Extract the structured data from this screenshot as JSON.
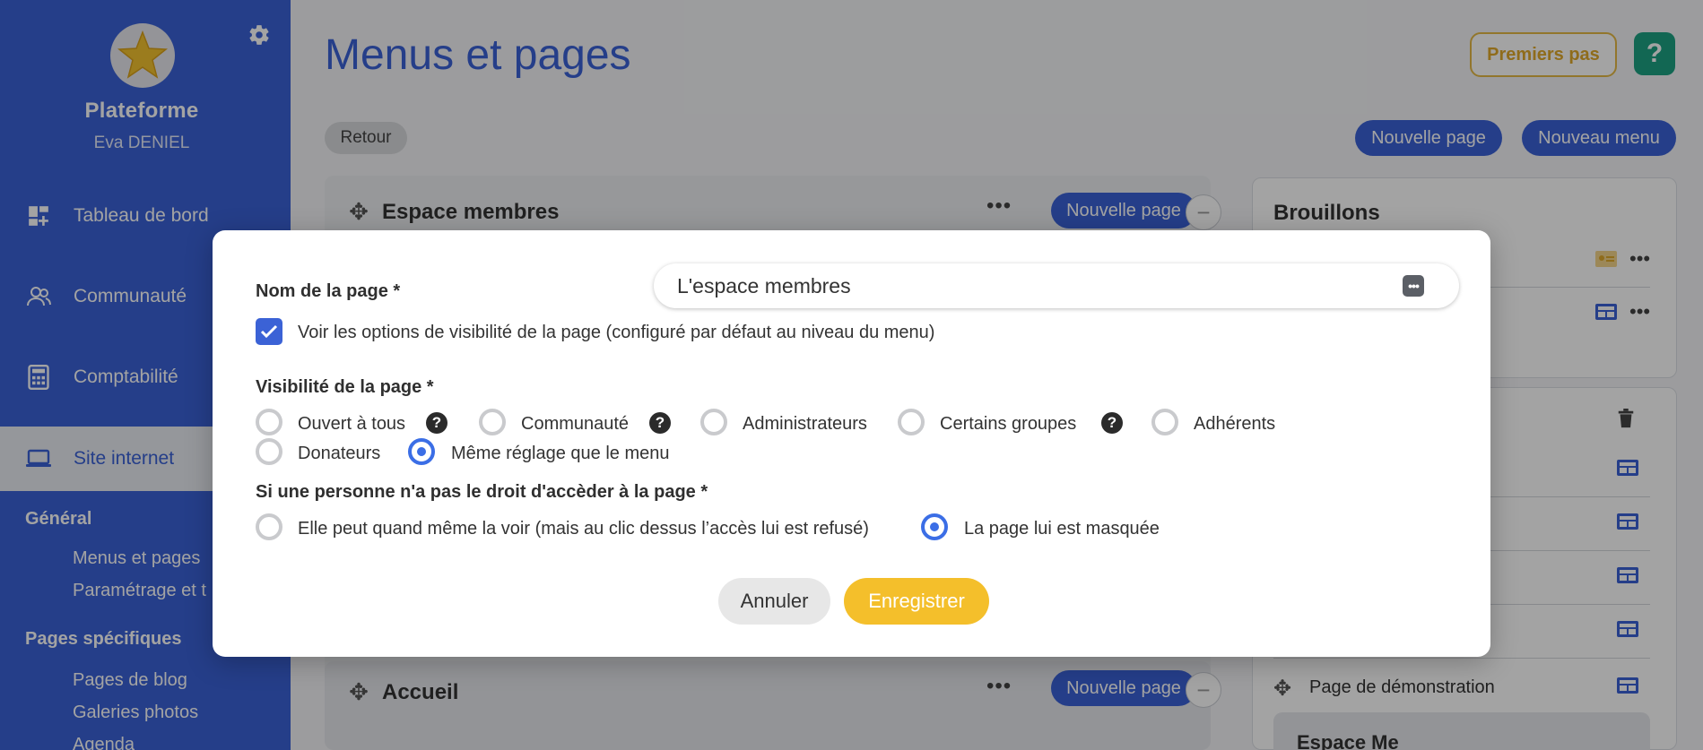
{
  "sidebar": {
    "org_name": "Plateforme",
    "user_name": "Eva DENIEL",
    "items": [
      {
        "label": "Tableau de bord",
        "icon": "dashboard-icon"
      },
      {
        "label": "Communauté",
        "icon": "community-icon"
      },
      {
        "label": "Comptabilité",
        "icon": "calculator-icon"
      },
      {
        "label": "Site internet",
        "icon": "laptop-icon",
        "active": true
      }
    ],
    "sections": [
      {
        "title": "Général",
        "links": [
          "Menus et pages",
          "Paramétrage et t"
        ]
      },
      {
        "title": "Pages spécifiques",
        "links": [
          "Pages de blog",
          "Galeries photos",
          "Agenda"
        ]
      }
    ]
  },
  "header": {
    "title": "Menus et pages",
    "premiers_pas": "Premiers pas",
    "help": "?",
    "retour": "Retour",
    "nouvelle_page": "Nouvelle page",
    "nouveau_menu": "Nouveau menu"
  },
  "menus": [
    {
      "title": "Espace membres",
      "dots": "•••",
      "button": "Nouvelle page",
      "collapse": "−"
    },
    {
      "title": "Accueil",
      "dots": "•••",
      "button": "Nouvelle page",
      "collapse": "−"
    }
  ],
  "drafts": {
    "title": "Brouillons",
    "demo_page": "Page de démonstration",
    "sub_menu": "Espace Me",
    "dots": "•••"
  },
  "modal": {
    "name_label": "Nom de la page *",
    "name_value": "L'espace membres",
    "name_button": "•••",
    "visibility_option_label": "Voir les options de visibilité de la page (configuré par défaut au niveau du menu)",
    "visibility_label": "Visibilité de la page *",
    "visibility_options": [
      "Ouvert à tous",
      "Communauté",
      "Administrateurs",
      "Certains groupes",
      "Adhérents",
      "Donateurs",
      "Même réglage que le menu"
    ],
    "visibility_selected": "Même réglage que le menu",
    "no_access_label": "Si une personne n'a pas le droit d'accèder à la page *",
    "no_access_options": [
      "Elle peut quand même la voir (mais au clic dessus l’accès lui est refusé)",
      "La page lui est masquée"
    ],
    "no_access_selected": "La page lui est masquée",
    "help_mark": "?",
    "cancel": "Annuler",
    "save": "Enregistrer"
  },
  "colors": {
    "primary": "#3b62d6",
    "accent": "#f4bf2b",
    "help": "#1da183",
    "radio": "#3b6ee6"
  }
}
